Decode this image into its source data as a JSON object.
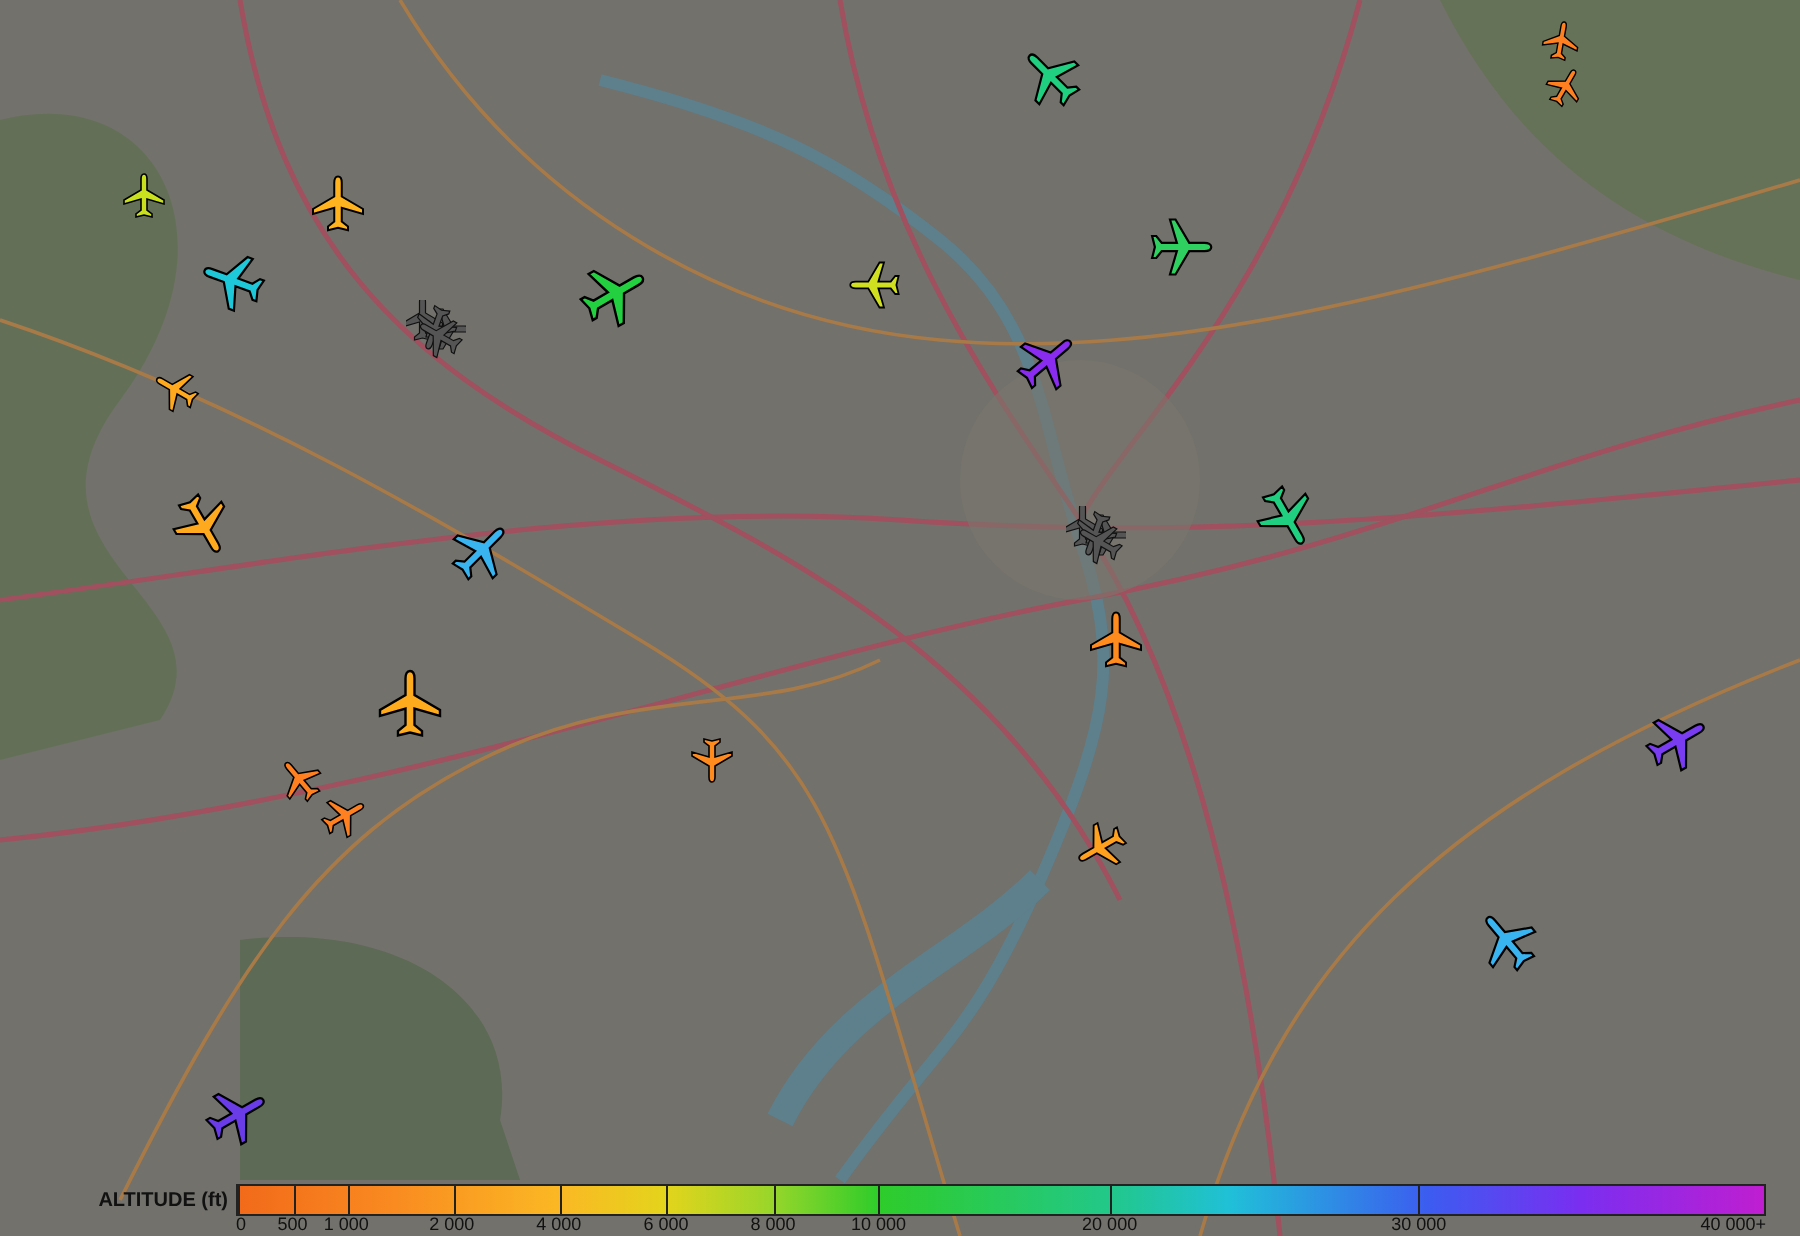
{
  "aircraft": [
    {
      "kind": "airborne",
      "color": "#c8e01e"
    },
    {
      "kind": "airborne",
      "color": "#ffb31e"
    },
    {
      "kind": "airborne",
      "color": "#1ec8d8"
    },
    {
      "kind": "airborne",
      "color": "#ffaa1e"
    },
    {
      "kind": "airborne",
      "color": "#ffaa1e"
    },
    {
      "kind": "airborne",
      "color": "#3ab4f0"
    },
    {
      "kind": "airborne",
      "color": "#22d040"
    },
    {
      "kind": "airborne",
      "color": "#d0e020"
    },
    {
      "kind": "airborne",
      "color": "#20d080"
    },
    {
      "kind": "airborne",
      "color": "#30d060"
    },
    {
      "kind": "airborne",
      "color": "#8a2cf0"
    },
    {
      "kind": "airborne",
      "color": "#20d080"
    },
    {
      "kind": "airborne",
      "color": "#ff8a1e"
    },
    {
      "kind": "airborne",
      "color": "#ffa01e"
    },
    {
      "kind": "airborne",
      "color": "#ff8a1e"
    },
    {
      "kind": "airborne",
      "color": "#ffab1e"
    },
    {
      "kind": "airborne",
      "color": "#ff8020"
    },
    {
      "kind": "airborne",
      "color": "#ff8020"
    },
    {
      "kind": "airborne",
      "color": "#ff8020"
    },
    {
      "kind": "airborne",
      "color": "#ff8020"
    },
    {
      "kind": "airborne",
      "color": "#7a3cf0"
    },
    {
      "kind": "airborne",
      "color": "#3ab4f0"
    },
    {
      "kind": "airborne",
      "color": "#6a3ce8"
    },
    {
      "kind": "ground"
    },
    {
      "kind": "ground"
    }
  ],
  "altitude_legend": {
    "title": "ALTITUDE (ft)",
    "ticks": [
      "0",
      "500",
      "1 000",
      "2 000",
      "4 000",
      "6 000",
      "8 000",
      "10 000",
      "20 000",
      "30 000",
      "40 000+"
    ]
  }
}
